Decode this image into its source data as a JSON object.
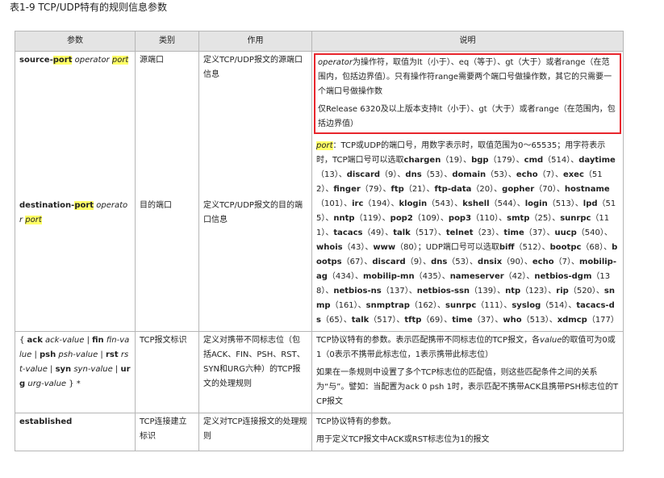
{
  "caption": "表1-9 TCP/UDP特有的规则信息参数",
  "headers": [
    "参数",
    "类别",
    "作用",
    "说明"
  ],
  "row1": {
    "param_src": {
      "a": "source-",
      "b": "port",
      "c": " operator ",
      "d": "port"
    },
    "param_dst": {
      "a": "destination-",
      "b": "port",
      "c": " operator ",
      "d": "port"
    },
    "cat_src": "源端口",
    "cat_dst": "目的端口",
    "eff_src": "定义TCP/UDP报文的源端口信息",
    "eff_dst": "定义TCP/UDP报文的目的端口信息",
    "op_word": "operator",
    "op_text": "为操作符，取值为lt（小于）、eq（等于）、gt（大于）或者range（在范围内，包括边界值）。只有操作符range需要两个端口号做操作数，其它的只需要一个端口号做操作数",
    "op_note": "仅Release 6320及以上版本支持lt（小于）、gt（大于）或者range（在范围内，包括边界值）",
    "port_word": "port",
    "port_intro": "：TCP或UDP的端口号，用数字表示时，取值范围为0～65535；用字符表示时，TCP端口号可以选取",
    "tcp_ports": [
      [
        "chargen",
        "19"
      ],
      [
        "bgp",
        "179"
      ],
      [
        "cmd",
        "514"
      ],
      [
        "daytime",
        "13"
      ],
      [
        "discard",
        "9"
      ],
      [
        "dns",
        "53"
      ],
      [
        "domain",
        "53"
      ],
      [
        "echo",
        "7"
      ],
      [
        "exec",
        "512"
      ],
      [
        "finger",
        "79"
      ],
      [
        "ftp",
        "21"
      ],
      [
        "ftp-data",
        "20"
      ],
      [
        "gopher",
        "70"
      ],
      [
        "hostname",
        "101"
      ],
      [
        "irc",
        "194"
      ],
      [
        "klogin",
        "543"
      ],
      [
        "kshell",
        "544"
      ],
      [
        "login",
        "513"
      ],
      [
        "lpd",
        "515"
      ],
      [
        "nntp",
        "119"
      ],
      [
        "pop2",
        "109"
      ],
      [
        "pop3",
        "110"
      ],
      [
        "smtp",
        "25"
      ],
      [
        "sunrpc",
        "111"
      ],
      [
        "tacacs",
        "49"
      ],
      [
        "talk",
        "517"
      ],
      [
        "telnet",
        "23"
      ],
      [
        "time",
        "37"
      ],
      [
        "uucp",
        "540"
      ],
      [
        "whois",
        "43"
      ],
      [
        "www",
        "80"
      ]
    ],
    "udp_intro": "UDP端口号可以选取",
    "udp_ports": [
      [
        "biff",
        "512"
      ],
      [
        "bootpc",
        "68"
      ],
      [
        "bootps",
        "67"
      ],
      [
        "discard",
        "9"
      ],
      [
        "dns",
        "53"
      ],
      [
        "dnsix",
        "90"
      ],
      [
        "echo",
        "7"
      ],
      [
        "mobilip-ag",
        "434"
      ],
      [
        "mobilip-mn",
        "435"
      ],
      [
        "nameserver",
        "42"
      ],
      [
        "netbios-dgm",
        "138"
      ],
      [
        "netbios-ns",
        "137"
      ],
      [
        "netbios-ssn",
        "139"
      ],
      [
        "ntp",
        "123"
      ],
      [
        "rip",
        "520"
      ],
      [
        "snmp",
        "161"
      ],
      [
        "snmptrap",
        "162"
      ],
      [
        "sunrpc",
        "111"
      ],
      [
        "syslog",
        "514"
      ],
      [
        "tacacs-ds",
        "65"
      ],
      [
        "talk",
        "517"
      ],
      [
        "tftp",
        "69"
      ],
      [
        "time",
        "37"
      ],
      [
        "who",
        "513"
      ],
      [
        "xdmcp",
        "177"
      ]
    ]
  },
  "row2": {
    "param": {
      "open": "{ ",
      "ack": "ack",
      "ack_v": " ack-value",
      "sep1": " | ",
      "fin": "fin",
      "fin_v": " fin-value",
      "sep2": " | ",
      "psh": "psh",
      "psh_v": " psh-value",
      "sep3": " | ",
      "rst": "rst",
      "rst_v": " rst-value",
      "sep4": " | ",
      "syn": "syn",
      "syn_v": " syn-value",
      "sep5": " | ",
      "urg": "urg",
      "urg_v": " urg-value",
      "close": " } *"
    },
    "category": "TCP报文标识",
    "effect": "定义对携带不同标志位（包括ACK、FIN、PSH、RST、SYN和URG六种）的TCP报文的处理规则",
    "desc1a": "TCP协议特有的参数。表示匹配携带不同标志位的TCP报文，各",
    "desc1_value": "value",
    "desc1b": "的取值可为0或1（0表示不携带此标志位，1表示携带此标志位）",
    "desc2": "如果在一条规则中设置了多个TCP标志位的匹配值，则这些匹配条件之间的关系为“与”。譬如：当配置为ack 0 psh 1时，表示匹配不携带ACK且携带PSH标志位的TCP报文"
  },
  "row3": {
    "param": "established",
    "category": "TCP连接建立标识",
    "effect": "定义对TCP连接报文的处理规则",
    "desc1": "TCP协议特有的参数。",
    "desc2": "用于定义TCP报文中ACK或RST标志位为1的报文"
  }
}
